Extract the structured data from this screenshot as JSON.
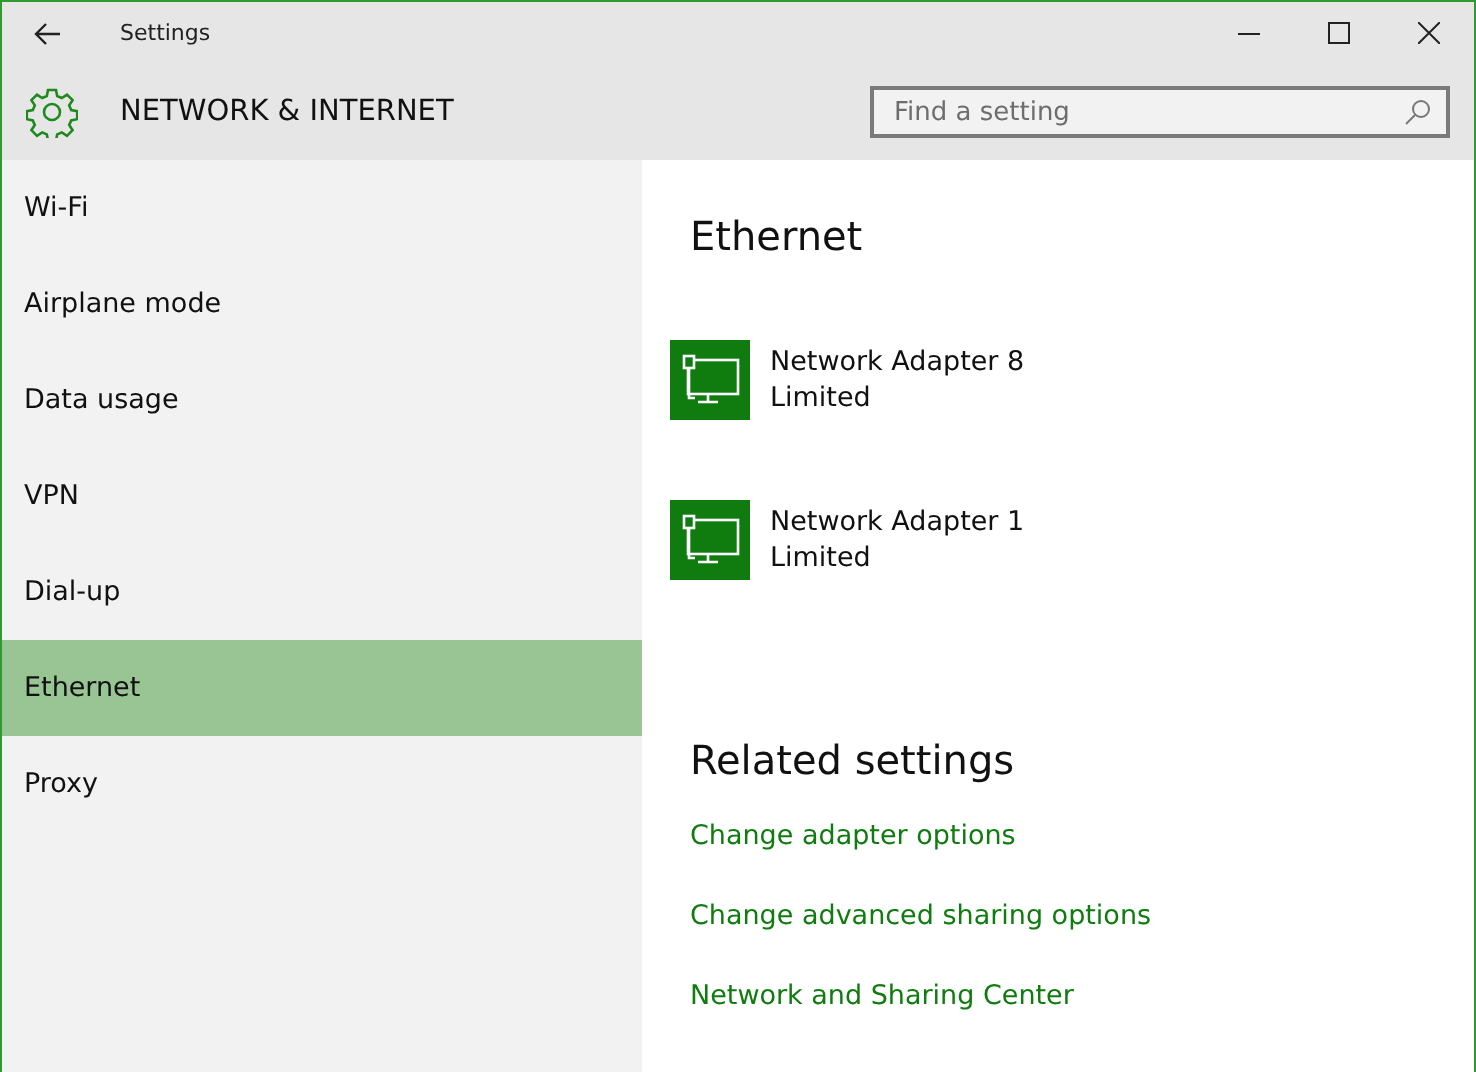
{
  "window": {
    "title": "Settings"
  },
  "header": {
    "title": "NETWORK & INTERNET",
    "search": {
      "placeholder": "Find a setting"
    }
  },
  "sidebar": {
    "items": [
      {
        "label": "Wi-Fi",
        "selected": false
      },
      {
        "label": "Airplane mode",
        "selected": false
      },
      {
        "label": "Data usage",
        "selected": false
      },
      {
        "label": "VPN",
        "selected": false
      },
      {
        "label": "Dial-up",
        "selected": false
      },
      {
        "label": "Ethernet",
        "selected": true
      },
      {
        "label": "Proxy",
        "selected": false
      }
    ]
  },
  "content": {
    "title": "Ethernet",
    "adapters": [
      {
        "name": "Network Adapter 8",
        "status": "Limited"
      },
      {
        "name": "Network Adapter 1",
        "status": "Limited"
      }
    ],
    "related_title": "Related settings",
    "links": [
      "Change adapter options",
      "Change advanced sharing options",
      "Network and Sharing Center"
    ]
  }
}
